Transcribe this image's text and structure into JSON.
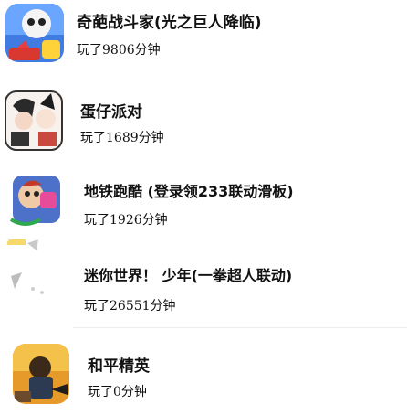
{
  "games": [
    {
      "title": "奇葩战斗家(光之巨人降临)",
      "subtitle": "玩了9806分钟",
      "icon": "game-icon-qipa"
    },
    {
      "title": "蛋仔派对",
      "subtitle": "玩了1689分钟",
      "icon": "game-icon-danzai"
    },
    {
      "title": "地铁跑酷 (登录领233联动滑板)",
      "subtitle": "玩了1926分钟",
      "icon": "game-icon-subway"
    },
    {
      "title": "迷你世界！ 少年(一拳超人联动)",
      "subtitle": "玩了26551分钟",
      "icon": "game-icon-mini-world"
    },
    {
      "title": "和平精英",
      "subtitle": "玩了0分钟",
      "icon": "game-icon-peace-elite"
    }
  ],
  "colors": {
    "text": "#111111",
    "divider": "#ececec",
    "qipa_bg": "#3a6fd8",
    "danzai_bg": "#ffffff",
    "subway_bg": "#5a7ad6",
    "peace_bg": "#e7a431"
  }
}
